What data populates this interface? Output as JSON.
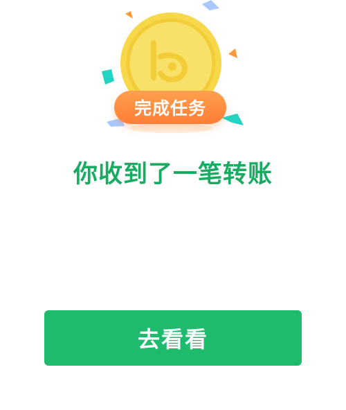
{
  "reward": {
    "badge_label": "完成任务",
    "coin_icon": "gold-coin-icon",
    "confetti_colors": [
      "#ff9a3c",
      "#23d3c4",
      "#a8c8ff"
    ],
    "coin_color": "#f7d84a"
  },
  "message": {
    "headline": "你收到了一笔转账"
  },
  "actions": {
    "view_label": "去看看",
    "button_color": "#1eba6e"
  }
}
